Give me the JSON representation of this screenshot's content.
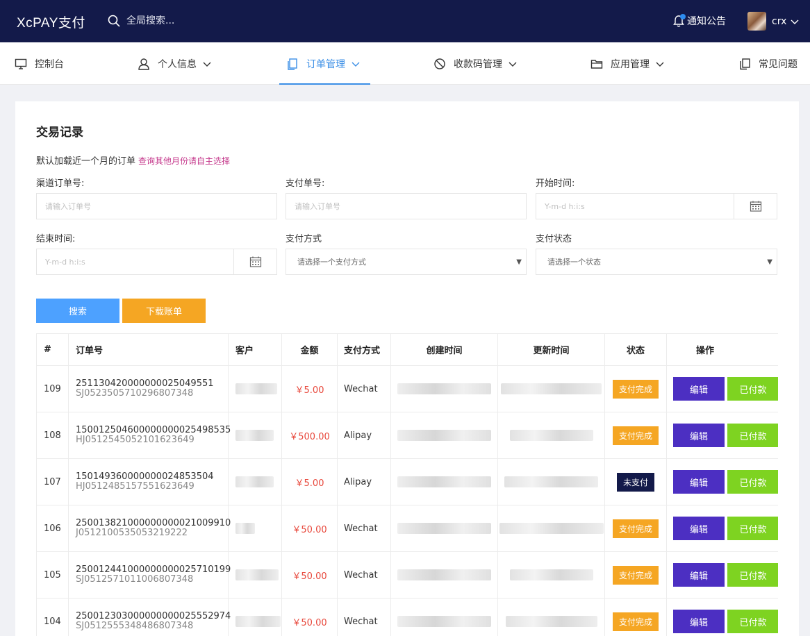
{
  "header": {
    "logo": "XcPAY支付",
    "search_placeholder": "全局搜索...",
    "notice_label": "通知公告",
    "username": "crx"
  },
  "nav": {
    "items": [
      {
        "label": "控制台",
        "icon": "monitor-icon",
        "dropdown": false
      },
      {
        "label": "个人信息",
        "icon": "user-icon",
        "dropdown": true
      },
      {
        "label": "订单管理",
        "icon": "document-icon",
        "dropdown": true,
        "active": true
      },
      {
        "label": "收款码管理",
        "icon": "ban-icon",
        "dropdown": true
      },
      {
        "label": "应用管理",
        "icon": "folder-icon",
        "dropdown": true
      },
      {
        "label": "常见问题",
        "icon": "copy-icon",
        "dropdown": false
      }
    ]
  },
  "page": {
    "title": "交易记录",
    "hint": "默认加载近一个月的订单",
    "hint_link": "查询其他月份请自主选择"
  },
  "filters": {
    "channel_order_label": "渠道订单号:",
    "channel_order_placeholder": "请输入订单号",
    "pay_order_label": "支付单号:",
    "pay_order_placeholder": "请输入订单号",
    "start_label": "开始时间:",
    "start_placeholder": "Y-m-d h:i:s",
    "end_label": "结束时间:",
    "end_placeholder": "Y-m-d h:i:s",
    "pay_method_label": "支付方式",
    "pay_method_placeholder": "请选择一个支付方式",
    "status_label": "支付状态",
    "status_placeholder": "请选择一个状态"
  },
  "buttons": {
    "search": "搜索",
    "download": "下载账单"
  },
  "table": {
    "headers": [
      "#",
      "订单号",
      "客户",
      "金额",
      "支付方式",
      "创建时间",
      "更新时间",
      "状态",
      "操作"
    ],
    "edit_label": "编辑",
    "mark_paid_label": "已付款",
    "rows": [
      {
        "id": "109",
        "order_no": "251130420000000025049551",
        "sub_no": "SJ0523505710296807348",
        "amount": "￥5.00",
        "method": "Wechat",
        "status": "支付完成",
        "paid": true
      },
      {
        "id": "108",
        "order_no": "150012504600000000025498535",
        "sub_no": "HJ0512545052101623649",
        "amount": "￥500.00",
        "method": "Alipay",
        "status": "支付完成",
        "paid": true
      },
      {
        "id": "107",
        "order_no": "150149360000000024853504",
        "sub_no": "HJ0512485157551623649",
        "amount": "￥5.00",
        "method": "Alipay",
        "status": "未支付",
        "paid": false
      },
      {
        "id": "106",
        "order_no": "250013821000000000021009910",
        "sub_no": "J0512100535053219222",
        "amount": "￥50.00",
        "method": "Wechat",
        "status": "支付完成",
        "paid": true
      },
      {
        "id": "105",
        "order_no": "250012441000000000025710199",
        "sub_no": "SJ0512571011006807348",
        "amount": "￥50.00",
        "method": "Wechat",
        "status": "支付完成",
        "paid": true
      },
      {
        "id": "104",
        "order_no": "250012303000000000025552974",
        "sub_no": "SJ0512555348486807348",
        "amount": "￥50.00",
        "method": "Wechat",
        "status": "支付完成",
        "paid": true
      }
    ]
  }
}
